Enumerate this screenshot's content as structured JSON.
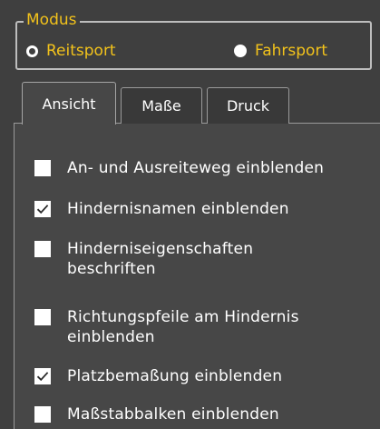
{
  "modus": {
    "legend": "Modus",
    "options": [
      {
        "label": "Reitsport",
        "selected": false
      },
      {
        "label": "Fahrsport",
        "selected": true
      }
    ]
  },
  "tabs": [
    {
      "label": "Ansicht",
      "active": true
    },
    {
      "label": "Maße",
      "active": false
    },
    {
      "label": "Druck",
      "active": false
    }
  ],
  "options": [
    {
      "label": "An- und Ausreiteweg einblenden",
      "checked": false
    },
    {
      "label": "Hindernisnamen einblenden",
      "checked": true
    },
    {
      "label_line1": "Hinderniseigenschaften",
      "label_line2": "beschriften",
      "checked": false
    },
    {
      "label_line1": "Richtungspfeile am Hindernis",
      "label_line2": "einblenden",
      "checked": false
    },
    {
      "label": "Platzbemaßung einblenden",
      "checked": true
    },
    {
      "label": "Maßstabbalken einblenden",
      "checked": false
    }
  ],
  "colors": {
    "accent": "#f2c21b",
    "panel": "#3f3f3f",
    "tab_content": "#474747",
    "check": "#2a2a2a"
  }
}
